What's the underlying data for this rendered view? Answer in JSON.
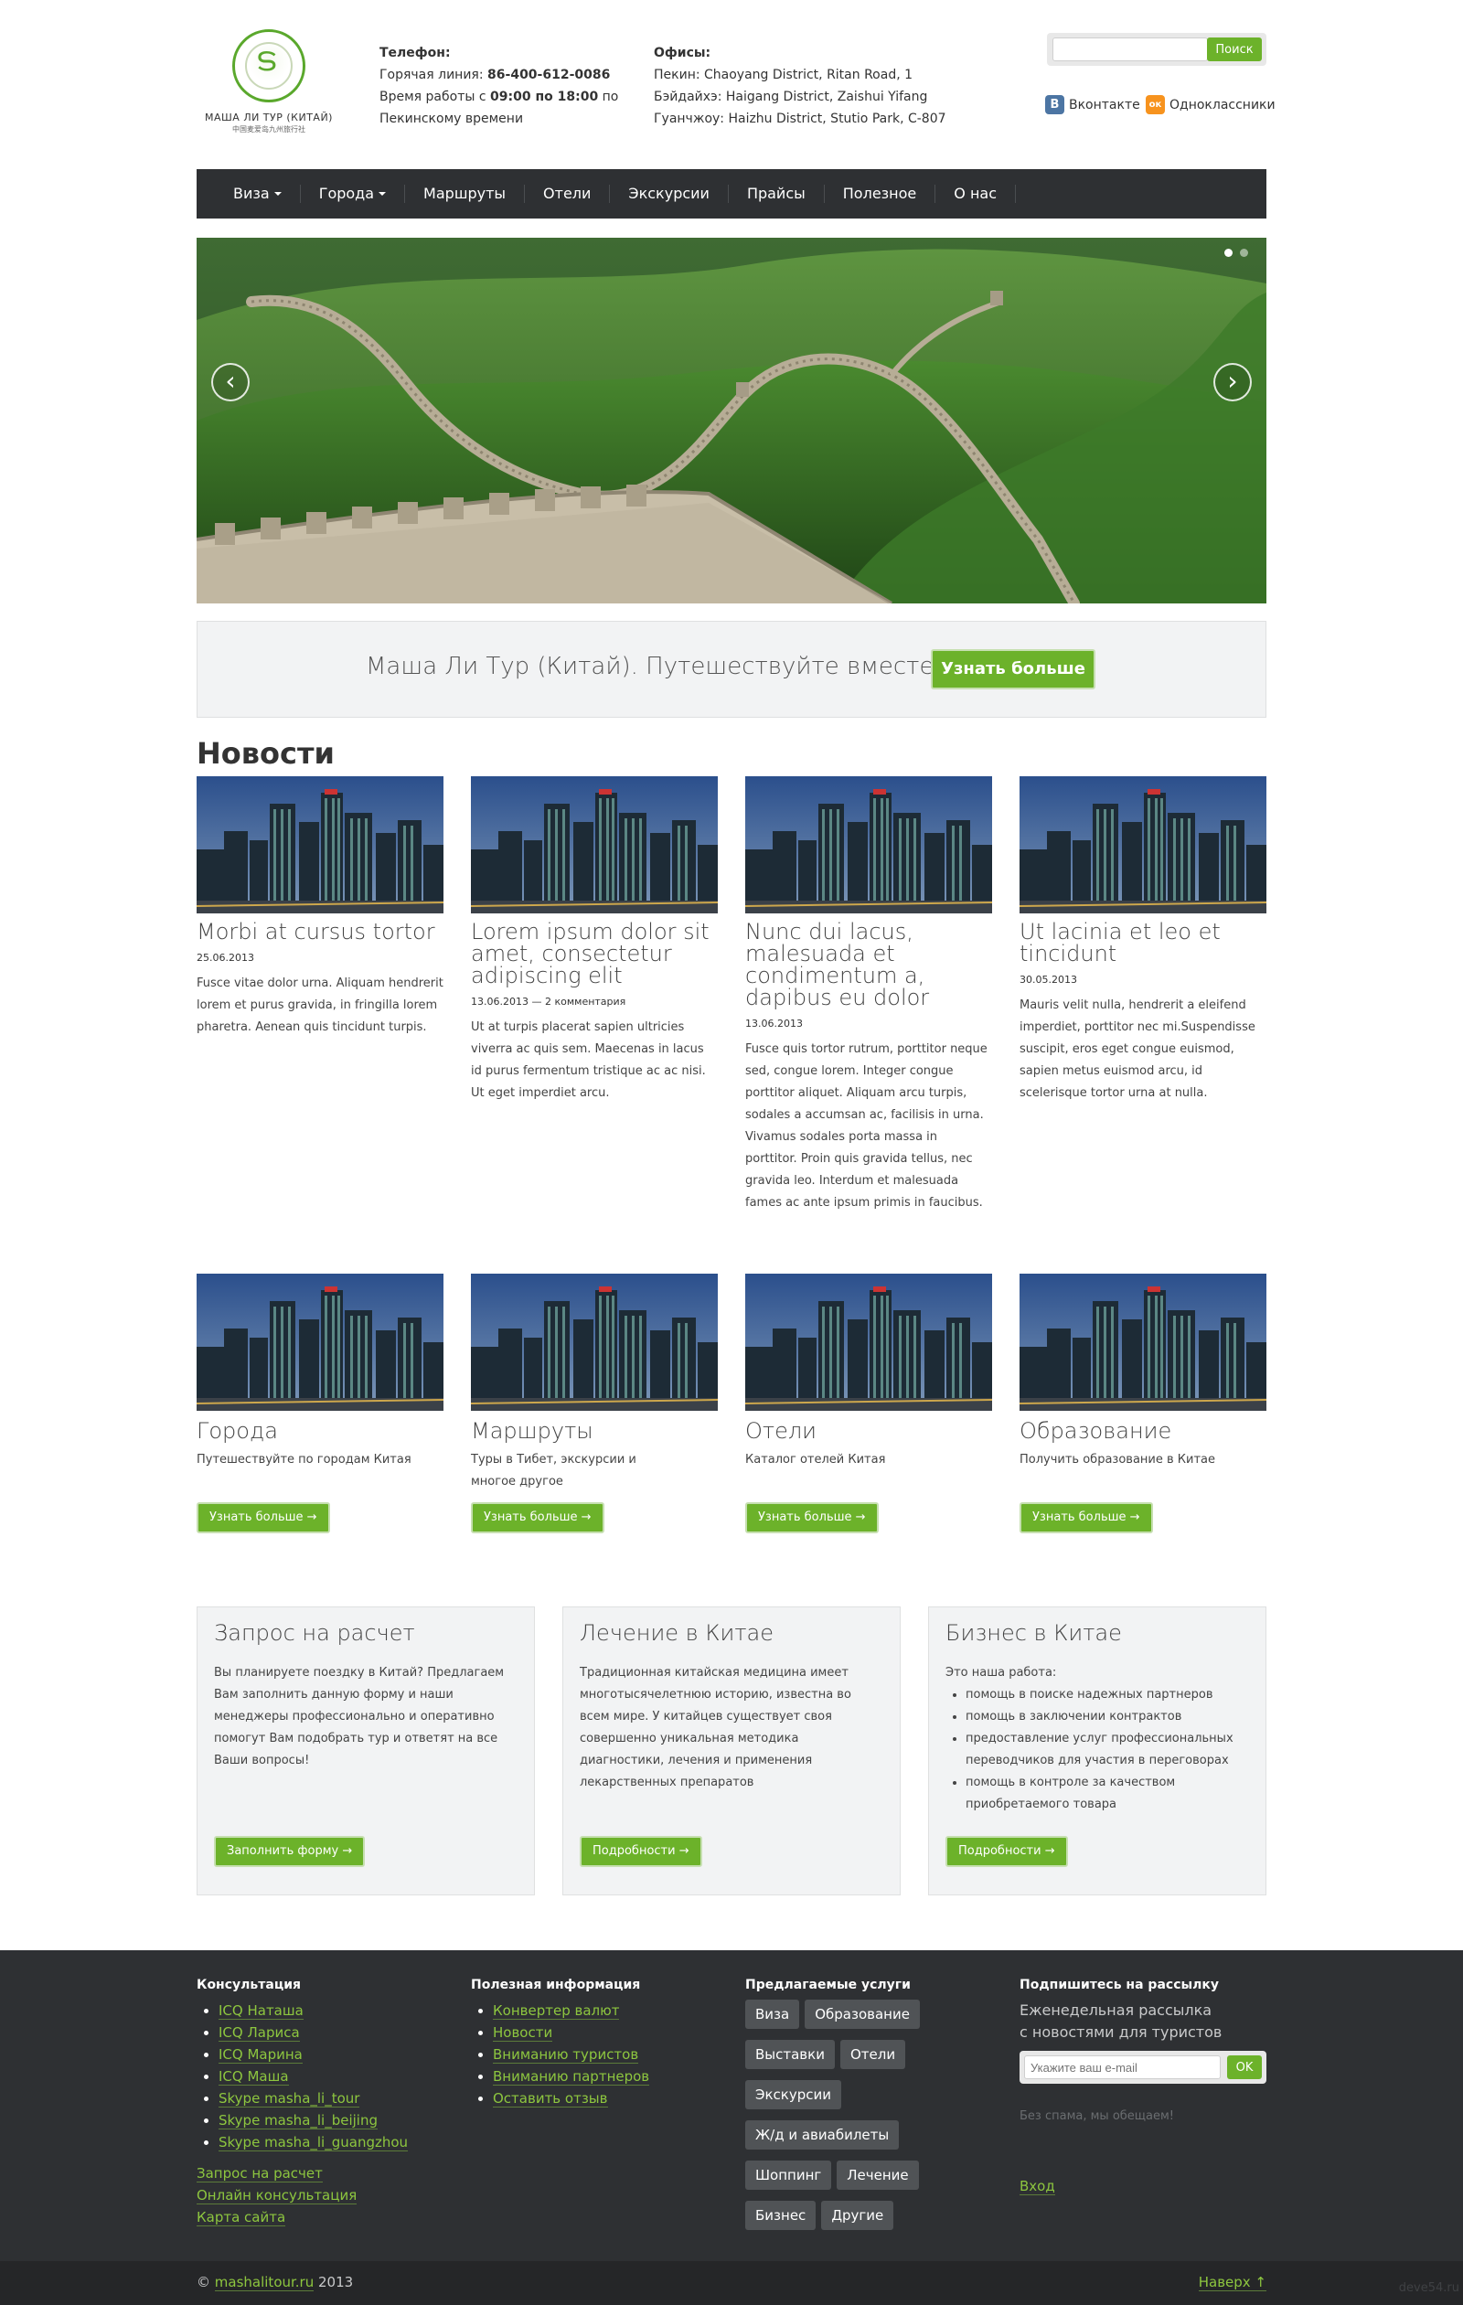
{
  "header": {
    "logo_name": "МАША ЛИ ТУР (КИТАЙ)",
    "logo_sub": "中国麦爱岛九州旅行社",
    "phone_title": "Телефон:",
    "hotline_label": "Горячая линия:",
    "hotline_number": "86-400-612-0086",
    "hours_prefix": "Время работы с",
    "hours_value": "09:00 по 18:00",
    "hours_suffix": "по",
    "hours_line2": "Пекинскому времени",
    "offices_title": "Офисы:",
    "offices": [
      "Пекин: Chaoyang District, Ritan Road, 1",
      "Бэйдайхэ: Haigang District, Zaishui Yifang",
      "Гуанчжоу: Haizhu District, Stutio Park, C-807"
    ],
    "search_placeholder": "",
    "search_button": "Поиск",
    "social": [
      {
        "label": "Вконтакте",
        "icon": "vk-icon",
        "letter": "В",
        "color": "#4c75a3"
      },
      {
        "label": "Одноклассники",
        "icon": "odnoklassniki-icon",
        "letter": "ок",
        "color": "#f7931e"
      }
    ]
  },
  "nav": {
    "items": [
      {
        "label": "Виза",
        "dropdown": true
      },
      {
        "label": "Города",
        "dropdown": true
      },
      {
        "label": "Маршруты",
        "dropdown": false
      },
      {
        "label": "Отели",
        "dropdown": false
      },
      {
        "label": "Экскурсии",
        "dropdown": false
      },
      {
        "label": "Прайсы",
        "dropdown": false
      },
      {
        "label": "Полезное",
        "dropdown": false
      },
      {
        "label": "О нас",
        "dropdown": false
      }
    ]
  },
  "slider": {
    "prev": "‹",
    "next": "›",
    "slides": 2,
    "active": 1
  },
  "hero": {
    "text": "Маша Ли Тур (Китай). Путешествуйте вместе с нами!",
    "button": "Узнать больше"
  },
  "news": {
    "title": "Новости",
    "items": [
      {
        "title": "Morbi at cursus tortor",
        "date": "25.06.2013",
        "text": "Fusce vitae dolor urna. Aliquam hendrerit lorem et purus gravida, in fringilla lorem pharetra. Aenean quis tincidunt turpis."
      },
      {
        "title": "Lorem ipsum dolor sit amet, consectetur adipiscing elit",
        "date": "13.06.2013 — 2 комментария",
        "text": "Ut at turpis placerat sapien ultricies viverra ac quis sem. Maecenas in lacus id purus fermentum tristique ac ac nisi. Ut eget imperdiet arcu."
      },
      {
        "title": "Nunc dui lacus, malesuada et condimentum a, dapibus eu dolor",
        "date": "13.06.2013",
        "text": "Fusce quis tortor rutrum, porttitor neque sed, congue lorem. Integer congue porttitor aliquet. Aliquam arcu turpis, sodales a accumsan ac, facilisis in urna. Vivamus sodales porta massa in porttitor. Proin quis gravida tellus, nec gravida leo. Interdum et malesuada fames ac ante ipsum primis in faucibus."
      },
      {
        "title": "Ut lacinia et leo et tincidunt",
        "date": "30.05.2013",
        "text": "Mauris velit nulla, hendrerit a eleifend imperdiet, porttitor nec mi.Suspendisse suscipit, eros eget congue euismod, sapien metus euismod arcu, id scelerisque tortor urna at nulla."
      }
    ]
  },
  "services": {
    "button": "Узнать больше →",
    "items": [
      {
        "title": "Города",
        "text": "Путешествуйте по городам Китая"
      },
      {
        "title": "Маршруты",
        "text": "Туры в Тибет, экскурсии и многое другое"
      },
      {
        "title": "Отели",
        "text": "Каталог отелей Китая"
      },
      {
        "title": "Образование",
        "text": "Получить образование в Китае"
      }
    ]
  },
  "boxes": {
    "request": {
      "title": "Запрос на расчет",
      "text": "Вы планируете поездку в Китай? Предлагаем Вам заполнить данную форму и наши менеджеры профессионально и оперативно помогут Вам подобрать тур и ответят на все Ваши вопросы!",
      "button": "Заполнить форму →"
    },
    "treatment": {
      "title": "Лечение в Китае",
      "text": "Традиционная китайская медицина имеет многотысячелетнюю историю, известна во всем мире. У китайцев существует своя совершенно уникальная методика диагностики, лечения и применения лекарственных препаратов",
      "button": "Подробности →"
    },
    "business": {
      "title": "Бизнес в Китае",
      "intro": "Это наша работа:",
      "list": [
        "помощь в поиске надежных партнеров",
        "помощь в заключении контрактов",
        "предоставление услуг профессиональных переводчиков для участия в переговорах",
        "помощь в контроле за качеством приобретаемого товара"
      ],
      "button": "Подробности →"
    }
  },
  "footer": {
    "consult": {
      "title": "Консультация",
      "links": [
        "ICQ Наташа",
        "ICQ Лариса",
        "ICQ Марина",
        "ICQ Маша",
        "Skype masha_li_tour",
        "Skype masha_li_beijing",
        "Skype masha_li_guangzhou"
      ],
      "extra": [
        "Запрос на расчет",
        "Онлайн консультация",
        "Карта сайта"
      ]
    },
    "useful": {
      "title": "Полезная информация",
      "links": [
        "Конвертер валют",
        "Новости",
        "Вниманию туристов",
        "Вниманию партнеров",
        "Оставить отзыв"
      ]
    },
    "services": {
      "title": "Предлагаемые услуги",
      "tags": [
        "Виза",
        "Образование",
        "Выставки",
        "Отели",
        "Экскурсии",
        "Ж/д и авиабилеты",
        "Шоппинг",
        "Лечение",
        "Бизнес",
        "Другие"
      ]
    },
    "subscribe": {
      "title": "Подпишитесь на рассылку",
      "text1": "Еженедельная рассылка",
      "text2": "с новостями для туристов",
      "placeholder": "Укажите ваш e-mail",
      "button": "OK",
      "nospam": "Без спама, мы обещаем!",
      "login": "Вход"
    }
  },
  "copyright": {
    "prefix": "©",
    "site": "mashalitour.ru",
    "year": "2013",
    "top": "Наверх ↑",
    "watermark": "deve54.ru"
  }
}
